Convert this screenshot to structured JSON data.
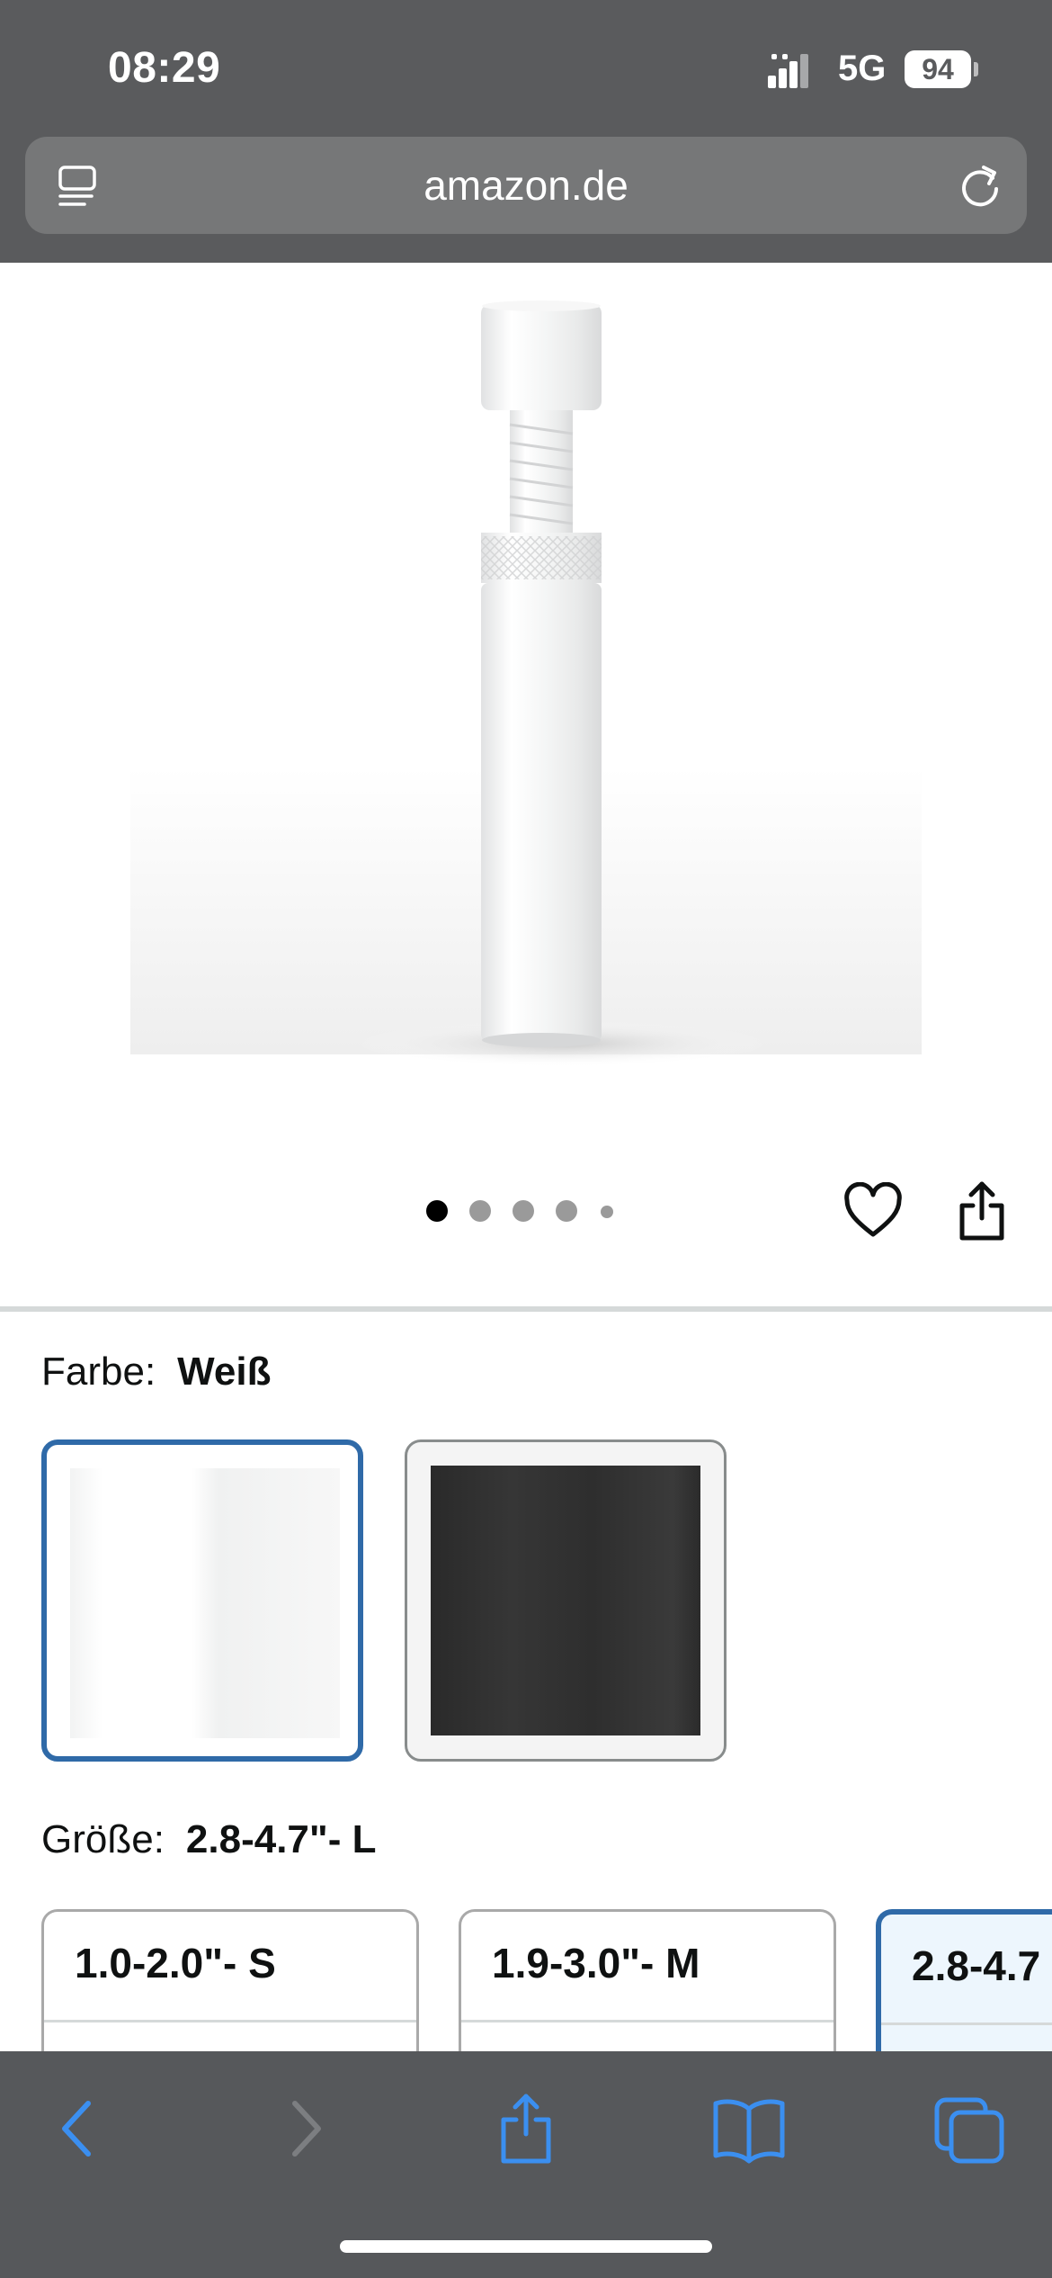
{
  "status_bar": {
    "time": "08:29",
    "network": "5G",
    "battery": "94"
  },
  "browser": {
    "url_host": "amazon.de",
    "icons": {
      "reader": "reader-mode-icon",
      "reload": "reload-icon"
    }
  },
  "gallery": {
    "image_count": 5,
    "active_index": 0,
    "icons": [
      "heart-icon",
      "share-icon"
    ]
  },
  "color_selector": {
    "label": "Farbe:",
    "selected": "Weiß",
    "options": [
      {
        "name": "white",
        "hex": "#ffffff",
        "selected": true
      },
      {
        "name": "black",
        "hex": "#2f2f2f",
        "selected": false
      }
    ]
  },
  "size_selector": {
    "label": "Größe:",
    "selected": "2.8-4.7\"- L",
    "options": [
      {
        "label": "1.0-2.0\"- S",
        "selected": false
      },
      {
        "label": "1.9-3.0\"- M",
        "selected": false
      },
      {
        "label": "2.8-4.7",
        "selected": true
      }
    ]
  },
  "toolbar": {
    "buttons": [
      "back-icon",
      "forward-icon",
      "share-icon",
      "bookmarks-icon",
      "tabs-icon"
    ]
  },
  "colors": {
    "chrome_bg": "#5a5b5d",
    "accent_blue": "#2f6aa8",
    "toolbar_icon_blue": "#3b8ff0"
  }
}
